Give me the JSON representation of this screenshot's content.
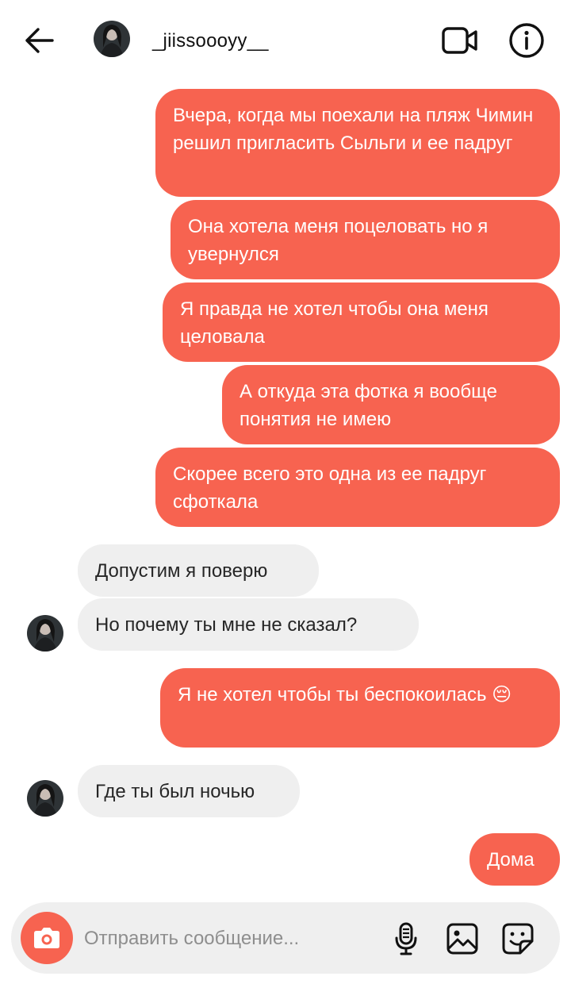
{
  "header": {
    "username": "_jiissoooyy__",
    "icons": {
      "back": "arrow-left-icon",
      "video": "video-camera-icon",
      "info": "info-icon"
    }
  },
  "messages": [
    {
      "sender": "me",
      "text": "Вчера, когда мы поехали на пляж Чимин решил пригласить Сыльги и ее падруг"
    },
    {
      "sender": "me",
      "text": "Она хотела меня поцеловать но я увернулся"
    },
    {
      "sender": "me",
      "text": "Я правда не хотел чтобы она меня целовала"
    },
    {
      "sender": "me",
      "text": "А откуда эта фотка я вообще понятия не имею"
    },
    {
      "sender": "me",
      "text": "Скорее всего это одна из ее падруг сфоткала"
    },
    {
      "sender": "them",
      "text": "Допустим я поверю"
    },
    {
      "sender": "them",
      "text": "Но почему ты мне не сказал?"
    },
    {
      "sender": "me",
      "text": "Я не хотел чтобы ты беспокоилась 😔"
    },
    {
      "sender": "them",
      "text": "Где ты был ночью"
    },
    {
      "sender": "me",
      "text": "Дома"
    }
  ],
  "composer": {
    "placeholder": "Отправить сообщение...",
    "value": "",
    "icons": {
      "camera": "camera-icon",
      "mic": "microphone-icon",
      "gallery": "gallery-icon",
      "sticker": "sticker-icon"
    }
  },
  "colors": {
    "outgoing": "#f76350",
    "incoming": "#efefef",
    "composer": "#efefef"
  }
}
